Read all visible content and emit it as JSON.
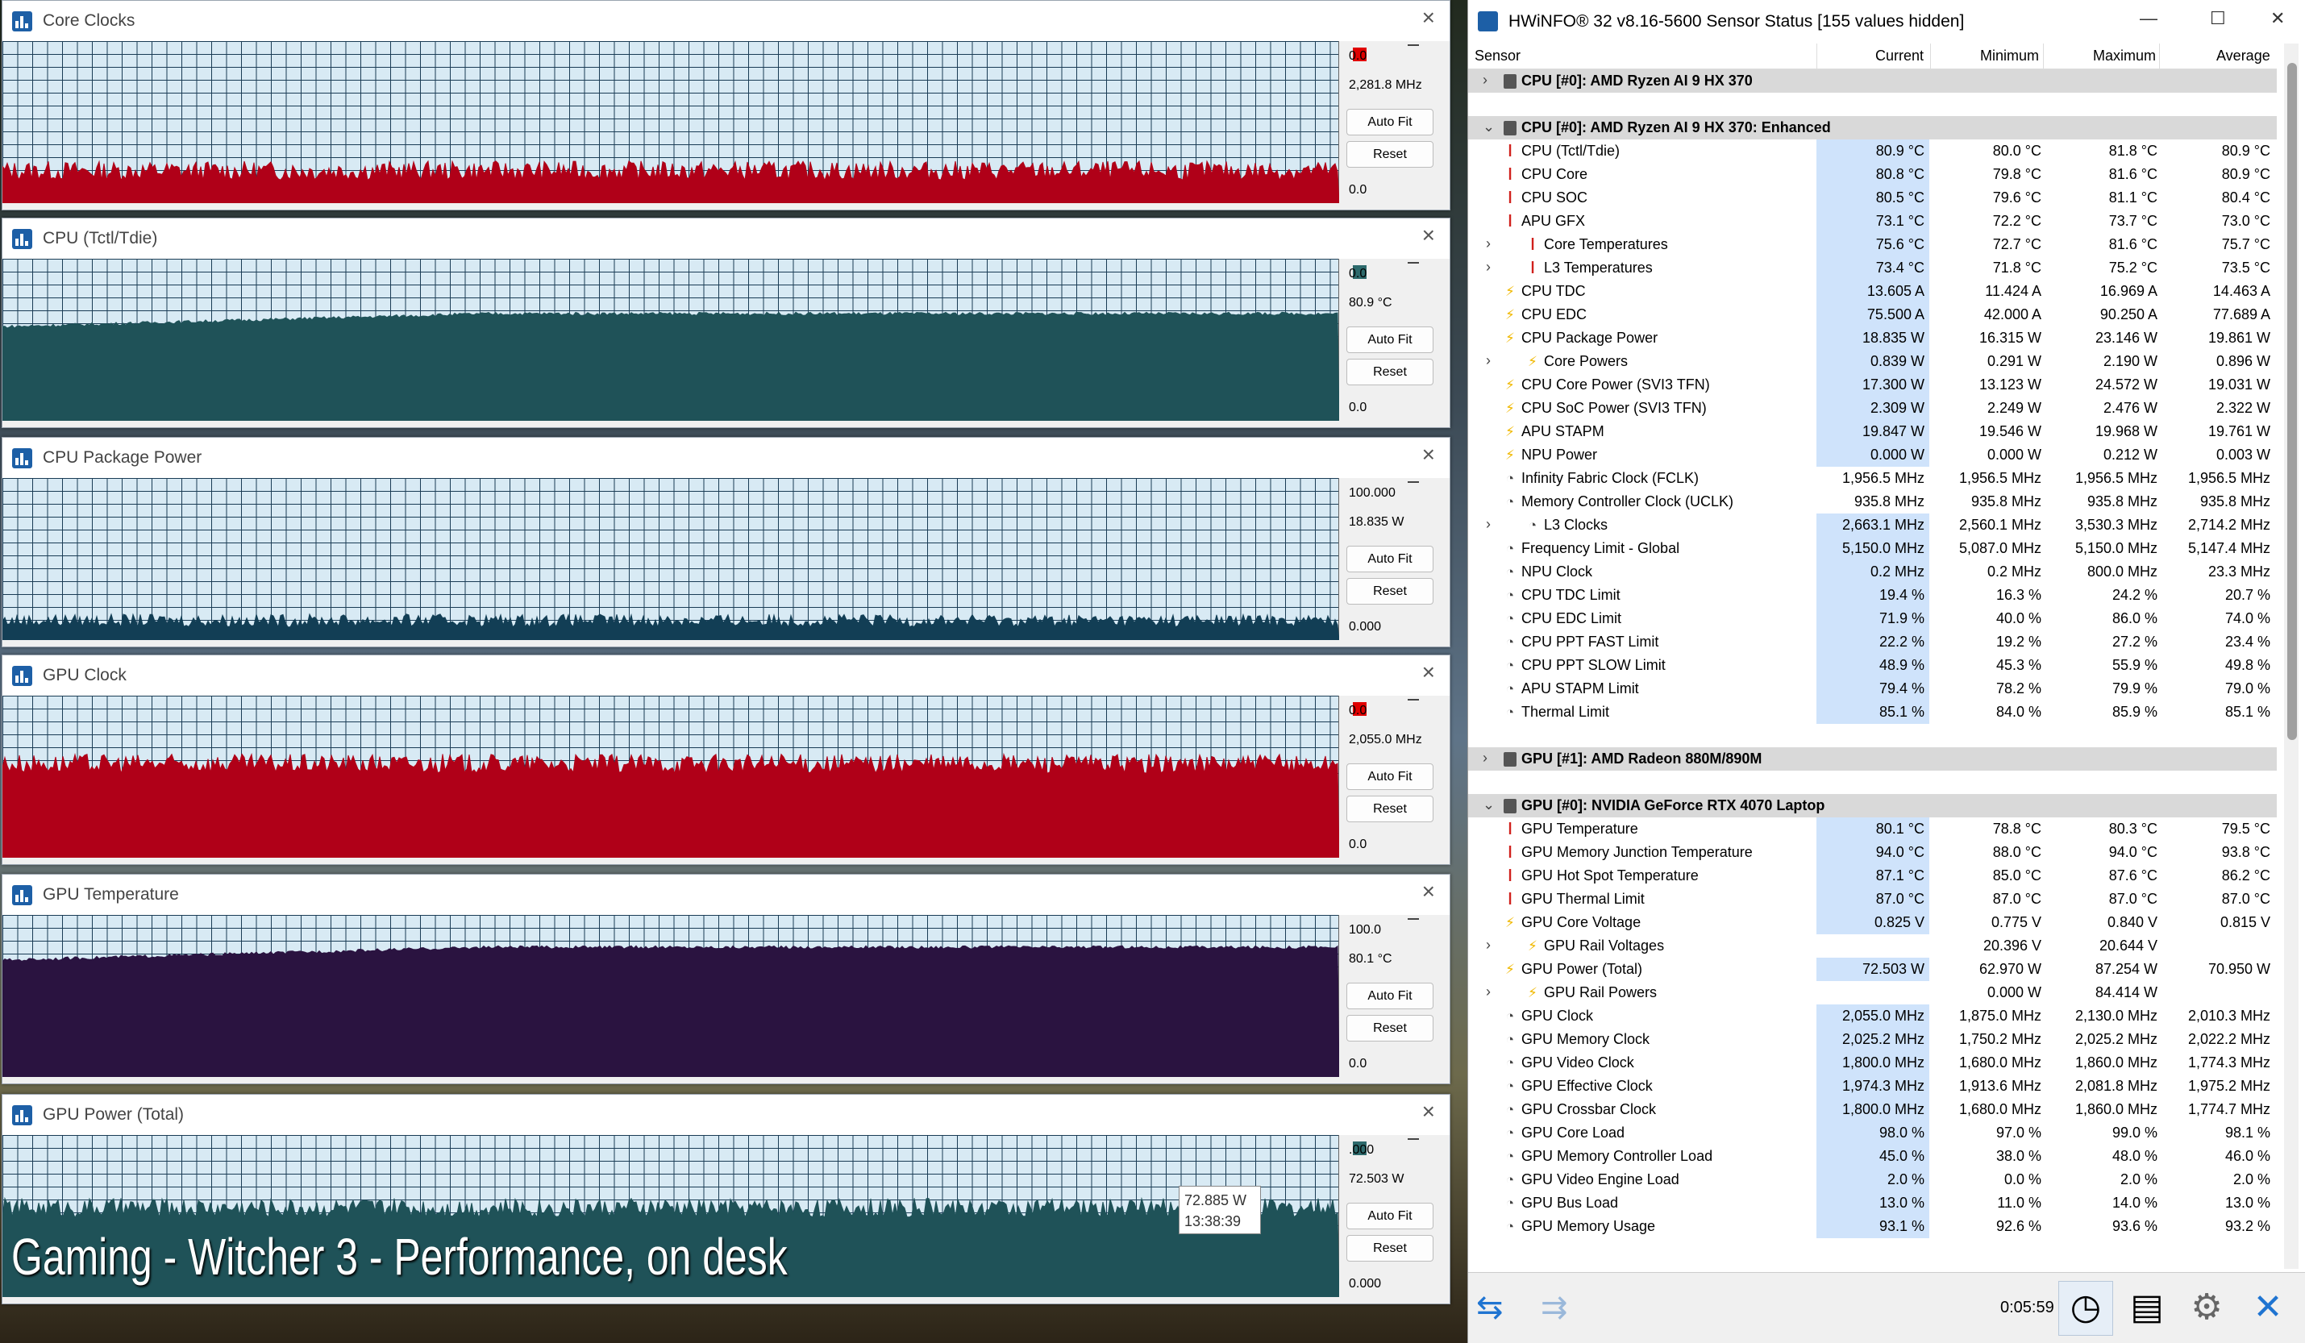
{
  "graph_windows": [
    {
      "title": "Core Clocks",
      "swatch": "#e00000",
      "top_label": "0.0",
      "current": "2,281.8 MHz",
      "bottom_label": "0.0",
      "auto_fit": "Auto Fit",
      "reset": "Reset",
      "bg": "#d8eaf4",
      "grid": "#1a3c55",
      "fill": "#b00018",
      "level": 0.2
    },
    {
      "title": "CPU (Tctl/Tdie)",
      "swatch": "#2d6a6c",
      "top_label": "0.0",
      "current": "80.9 °C",
      "bottom_label": "0.0",
      "auto_fit": "Auto Fit",
      "reset": "Reset",
      "bg": "#d8eaf4",
      "grid": "#1a3c55",
      "fill": "#1f5258",
      "level": 0.66
    },
    {
      "title": "CPU Package Power",
      "swatch": null,
      "top_label": "100.000",
      "current": "18.835 W",
      "bottom_label": "0.000",
      "auto_fit": "Auto Fit",
      "reset": "Reset",
      "bg": "#d8eaf4",
      "grid": "#1a3c55",
      "fill": "#123e55",
      "level": 0.12
    },
    {
      "title": "GPU Clock",
      "swatch": "#e00000",
      "top_label": "0.0",
      "current": "2,055.0 MHz",
      "bottom_label": "0.0",
      "auto_fit": "Auto Fit",
      "reset": "Reset",
      "bg": "#d8eaf4",
      "grid": "#1a3c55",
      "fill": "#b00018",
      "level": 0.58
    },
    {
      "title": "GPU Temperature",
      "swatch": null,
      "top_label": "100.0",
      "current": "80.1 °C",
      "bottom_label": "0.0",
      "auto_fit": "Auto Fit",
      "reset": "Reset",
      "bg": "#d8eaf4",
      "grid": "#1a3c55",
      "fill": "#2a1340",
      "level": 0.8
    },
    {
      "title": "GPU Power (Total)",
      "swatch": "#2d6a6c",
      "top_label": ".000",
      "current": "72.503 W",
      "bottom_label": "0.000",
      "auto_fit": "Auto Fit",
      "reset": "Reset",
      "bg": "#d8eaf4",
      "grid": "#1a3c55",
      "fill": "#1f5258",
      "level": 0.55
    }
  ],
  "tooltip": {
    "value": "72.885 W",
    "time": "13:38:39"
  },
  "overlay_text": "Gaming - Witcher 3 - Performance, on desk",
  "hwinfo": {
    "title": "HWiNFO® 32 v8.16-5600 Sensor Status [155 values hidden]",
    "columns": {
      "sensor": "Sensor",
      "current": "Current",
      "minimum": "Minimum",
      "maximum": "Maximum",
      "average": "Average"
    },
    "elapsed": "0:05:59",
    "rows": [
      {
        "kind": "grp",
        "exp": "›",
        "label": "CPU [#0]: AMD Ryzen AI 9 HX 370"
      },
      {
        "kind": "gap"
      },
      {
        "kind": "grp",
        "exp": "⌄",
        "label": "CPU [#0]: AMD Ryzen AI 9 HX 370: Enhanced"
      },
      {
        "icon": "therm",
        "label": "CPU (Tctl/Tdie)",
        "cur": "80.9 °C",
        "min": "80.0 °C",
        "max": "81.8 °C",
        "avg": "80.9 °C"
      },
      {
        "icon": "therm",
        "label": "CPU Core",
        "cur": "80.8 °C",
        "min": "79.8 °C",
        "max": "81.6 °C",
        "avg": "80.9 °C"
      },
      {
        "icon": "therm",
        "label": "CPU SOC",
        "cur": "80.5 °C",
        "min": "79.6 °C",
        "max": "81.1 °C",
        "avg": "80.4 °C"
      },
      {
        "icon": "therm",
        "label": "APU GFX",
        "cur": "73.1 °C",
        "min": "72.2 °C",
        "max": "73.7 °C",
        "avg": "73.0 °C"
      },
      {
        "icon": "therm",
        "sub": true,
        "label": "Core Temperatures",
        "cur": "75.6 °C",
        "min": "72.7 °C",
        "max": "81.6 °C",
        "avg": "75.7 °C"
      },
      {
        "icon": "therm",
        "sub": true,
        "label": "L3 Temperatures",
        "cur": "73.4 °C",
        "min": "71.8 °C",
        "max": "75.2 °C",
        "avg": "73.5 °C"
      },
      {
        "icon": "bolt",
        "label": "CPU TDC",
        "cur": "13.605 A",
        "min": "11.424 A",
        "max": "16.969 A",
        "avg": "14.463 A"
      },
      {
        "icon": "bolt",
        "label": "CPU EDC",
        "cur": "75.500 A",
        "min": "42.000 A",
        "max": "90.250 A",
        "avg": "77.689 A"
      },
      {
        "icon": "bolt",
        "label": "CPU Package Power",
        "cur": "18.835 W",
        "min": "16.315 W",
        "max": "23.146 W",
        "avg": "19.861 W"
      },
      {
        "icon": "bolt",
        "sub": true,
        "label": "Core Powers",
        "cur": "0.839 W",
        "min": "0.291 W",
        "max": "2.190 W",
        "avg": "0.896 W"
      },
      {
        "icon": "bolt",
        "label": "CPU Core Power (SVI3 TFN)",
        "cur": "17.300 W",
        "min": "13.123 W",
        "max": "24.572 W",
        "avg": "19.031 W"
      },
      {
        "icon": "bolt",
        "label": "CPU SoC Power (SVI3 TFN)",
        "cur": "2.309 W",
        "min": "2.249 W",
        "max": "2.476 W",
        "avg": "2.322 W"
      },
      {
        "icon": "bolt",
        "label": "APU STAPM",
        "cur": "19.847 W",
        "min": "19.546 W",
        "max": "19.968 W",
        "avg": "19.761 W"
      },
      {
        "icon": "bolt",
        "label": "NPU Power",
        "cur": "0.000 W",
        "min": "0.000 W",
        "max": "0.212 W",
        "avg": "0.003 W"
      },
      {
        "icon": "clk",
        "label": "Infinity Fabric Clock (FCLK)",
        "cur": "1,956.5 MHz",
        "na": true,
        "min": "1,956.5 MHz",
        "max": "1,956.5 MHz",
        "avg": "1,956.5 MHz"
      },
      {
        "icon": "clk",
        "label": "Memory Controller Clock (UCLK)",
        "cur": "935.8 MHz",
        "na": true,
        "min": "935.8 MHz",
        "max": "935.8 MHz",
        "avg": "935.8 MHz"
      },
      {
        "icon": "clk",
        "sub": true,
        "label": "L3 Clocks",
        "cur": "2,663.1 MHz",
        "min": "2,560.1 MHz",
        "max": "3,530.3 MHz",
        "avg": "2,714.2 MHz"
      },
      {
        "icon": "clk",
        "label": "Frequency Limit - Global",
        "cur": "5,150.0 MHz",
        "min": "5,087.0 MHz",
        "max": "5,150.0 MHz",
        "avg": "5,147.4 MHz"
      },
      {
        "icon": "clk",
        "label": "NPU Clock",
        "cur": "0.2 MHz",
        "min": "0.2 MHz",
        "max": "800.0 MHz",
        "avg": "23.3 MHz"
      },
      {
        "icon": "clk",
        "label": "CPU TDC Limit",
        "cur": "19.4 %",
        "min": "16.3 %",
        "max": "24.2 %",
        "avg": "20.7 %"
      },
      {
        "icon": "clk",
        "label": "CPU EDC Limit",
        "cur": "71.9 %",
        "min": "40.0 %",
        "max": "86.0 %",
        "avg": "74.0 %"
      },
      {
        "icon": "clk",
        "label": "CPU PPT FAST Limit",
        "cur": "22.2 %",
        "min": "19.2 %",
        "max": "27.2 %",
        "avg": "23.4 %"
      },
      {
        "icon": "clk",
        "label": "CPU PPT SLOW Limit",
        "cur": "48.9 %",
        "min": "45.3 %",
        "max": "55.9 %",
        "avg": "49.8 %"
      },
      {
        "icon": "clk",
        "label": "APU STAPM Limit",
        "cur": "79.4 %",
        "min": "78.2 %",
        "max": "79.9 %",
        "avg": "79.0 %"
      },
      {
        "icon": "clk",
        "label": "Thermal Limit",
        "cur": "85.1 %",
        "min": "84.0 %",
        "max": "85.9 %",
        "avg": "85.1 %"
      },
      {
        "kind": "gap"
      },
      {
        "kind": "grp",
        "exp": "›",
        "label": "GPU [#1]: AMD Radeon 880M/890M"
      },
      {
        "kind": "gap"
      },
      {
        "kind": "grp",
        "exp": "⌄",
        "label": "GPU [#0]: NVIDIA GeForce RTX 4070 Laptop"
      },
      {
        "icon": "therm",
        "label": "GPU Temperature",
        "cur": "80.1 °C",
        "min": "78.8 °C",
        "max": "80.3 °C",
        "avg": "79.5 °C"
      },
      {
        "icon": "therm",
        "label": "GPU Memory Junction Temperature",
        "cur": "94.0 °C",
        "min": "88.0 °C",
        "max": "94.0 °C",
        "avg": "93.8 °C"
      },
      {
        "icon": "therm",
        "label": "GPU Hot Spot Temperature",
        "cur": "87.1 °C",
        "min": "85.0 °C",
        "max": "87.6 °C",
        "avg": "86.2 °C"
      },
      {
        "icon": "therm",
        "label": "GPU Thermal Limit",
        "cur": "87.0 °C",
        "min": "87.0 °C",
        "max": "87.0 °C",
        "avg": "87.0 °C"
      },
      {
        "icon": "bolt",
        "label": "GPU Core Voltage",
        "cur": "0.825 V",
        "min": "0.775 V",
        "max": "0.840 V",
        "avg": "0.815 V"
      },
      {
        "icon": "bolt",
        "sub": true,
        "label": "GPU Rail Voltages",
        "cur": "",
        "na": true,
        "min": "20.396 V",
        "max": "20.644 V",
        "avg": ""
      },
      {
        "icon": "bolt",
        "label": "GPU Power (Total)",
        "cur": "72.503 W",
        "min": "62.970 W",
        "max": "87.254 W",
        "avg": "70.950 W"
      },
      {
        "icon": "bolt",
        "sub": true,
        "label": "GPU Rail Powers",
        "cur": "",
        "na": true,
        "min": "0.000 W",
        "max": "84.414 W",
        "avg": ""
      },
      {
        "icon": "clk",
        "label": "GPU Clock",
        "cur": "2,055.0 MHz",
        "min": "1,875.0 MHz",
        "max": "2,130.0 MHz",
        "avg": "2,010.3 MHz"
      },
      {
        "icon": "clk",
        "label": "GPU Memory Clock",
        "cur": "2,025.2 MHz",
        "min": "1,750.2 MHz",
        "max": "2,025.2 MHz",
        "avg": "2,022.2 MHz"
      },
      {
        "icon": "clk",
        "label": "GPU Video Clock",
        "cur": "1,800.0 MHz",
        "min": "1,680.0 MHz",
        "max": "1,860.0 MHz",
        "avg": "1,774.3 MHz"
      },
      {
        "icon": "clk",
        "label": "GPU Effective Clock",
        "cur": "1,974.3 MHz",
        "min": "1,913.6 MHz",
        "max": "2,081.8 MHz",
        "avg": "1,975.2 MHz"
      },
      {
        "icon": "clk",
        "label": "GPU Crossbar Clock",
        "cur": "1,800.0 MHz",
        "min": "1,680.0 MHz",
        "max": "1,860.0 MHz",
        "avg": "1,774.7 MHz"
      },
      {
        "icon": "clk",
        "label": "GPU Core Load",
        "cur": "98.0 %",
        "min": "97.0 %",
        "max": "99.0 %",
        "avg": "98.1 %"
      },
      {
        "icon": "clk",
        "label": "GPU Memory Controller Load",
        "cur": "45.0 %",
        "min": "38.0 %",
        "max": "48.0 %",
        "avg": "46.0 %"
      },
      {
        "icon": "clk",
        "label": "GPU Video Engine Load",
        "cur": "2.0 %",
        "min": "0.0 %",
        "max": "2.0 %",
        "avg": "2.0 %"
      },
      {
        "icon": "clk",
        "label": "GPU Bus Load",
        "cur": "13.0 %",
        "min": "11.0 %",
        "max": "14.0 %",
        "avg": "13.0 %"
      },
      {
        "icon": "clk",
        "label": "GPU Memory Usage",
        "cur": "93.1 %",
        "min": "92.6 %",
        "max": "93.6 %",
        "avg": "93.2 %"
      }
    ]
  }
}
